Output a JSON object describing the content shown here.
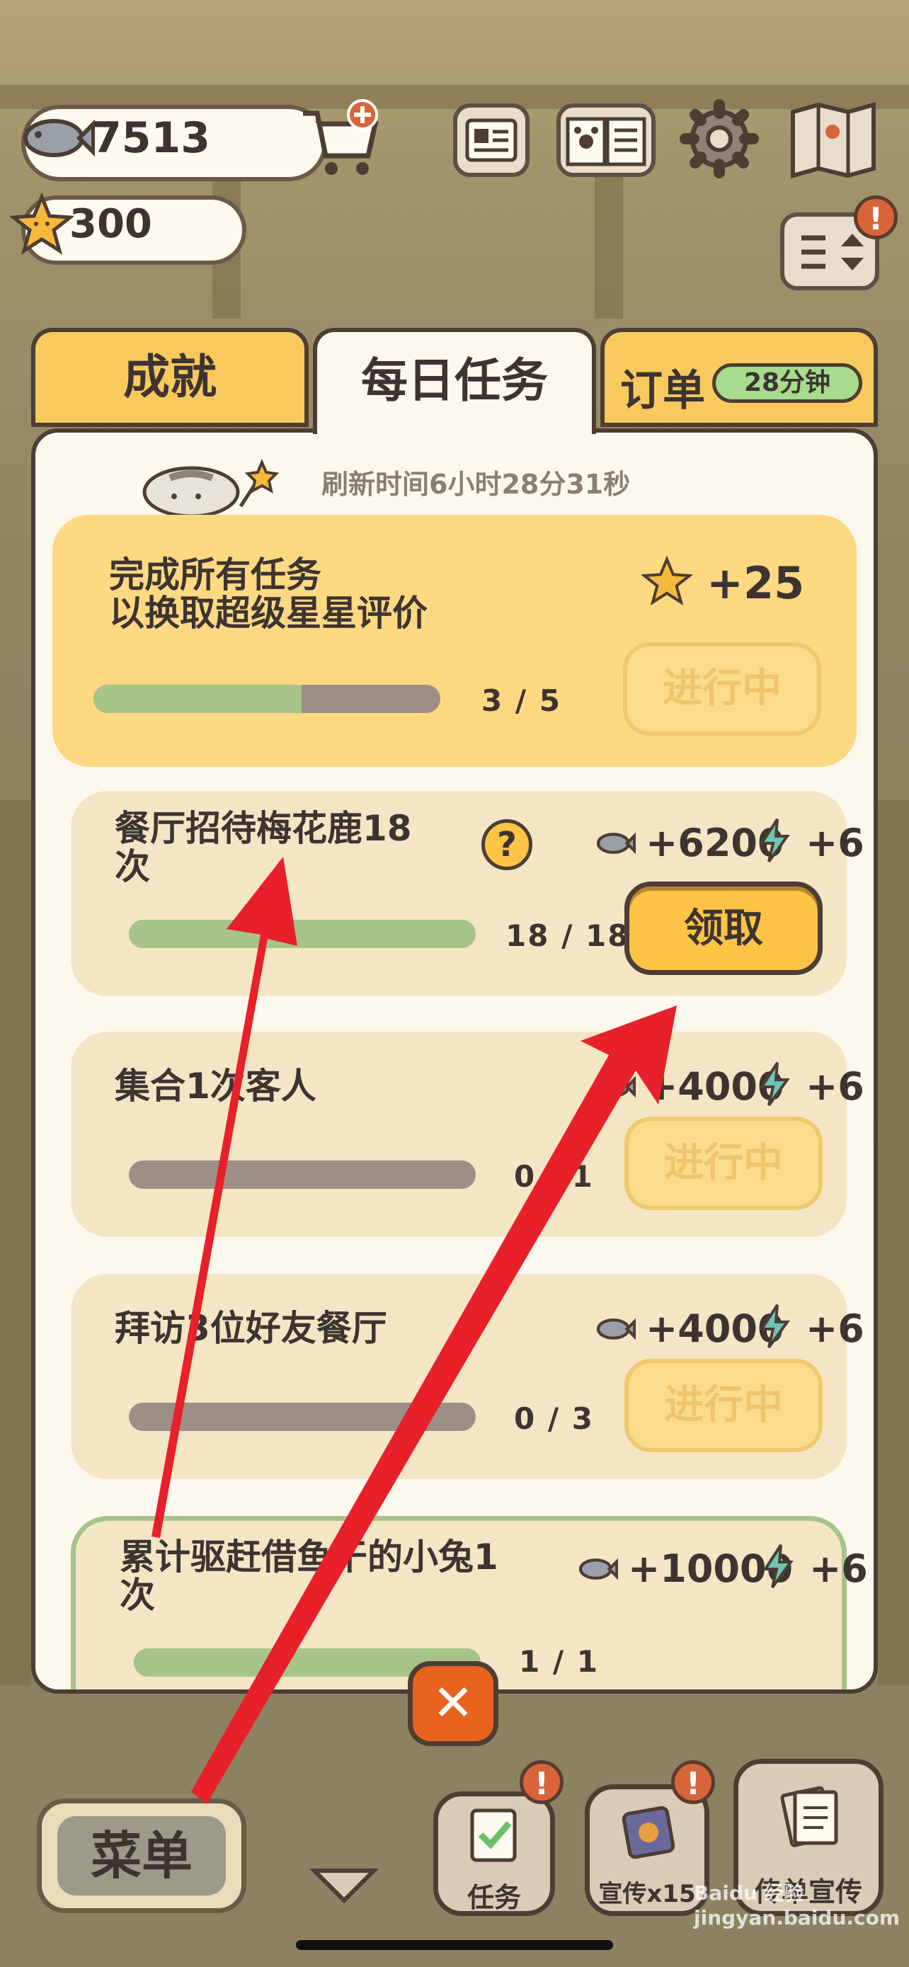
{
  "currency": {
    "fish": "7513",
    "stars": "300"
  },
  "tabs": [
    {
      "label": "成就"
    },
    {
      "label": "每日任务"
    },
    {
      "label": "订单",
      "timer": "28分钟"
    }
  ],
  "refresh_text": "刷新时间6小时28分31秒",
  "tasks": [
    {
      "title": "完成所有任务\n以换取超级星星评价",
      "reward_star": "+25",
      "progress": "3 / 5",
      "progress_fraction": 0.6,
      "button": "进行中"
    },
    {
      "title": "餐厅招待梅花鹿18\n次",
      "reward_fish": "+6200",
      "reward_energy": "+6",
      "progress": "18 / 18",
      "progress_fraction": 1.0,
      "button": "领取"
    },
    {
      "title": "集合1次客人",
      "reward_fish": "+4000",
      "reward_energy": "+6",
      "progress": "0 / 1",
      "progress_fraction": 0,
      "button": "进行中"
    },
    {
      "title": "拜访3位好友餐厅",
      "reward_fish": "+4000",
      "reward_energy": "+6",
      "progress": "0 / 3",
      "progress_fraction": 0,
      "button": "进行中"
    },
    {
      "title": "累计驱赶借鱼干的小兔1\n次",
      "reward_fish": "+10000",
      "reward_energy": "+6",
      "progress": "1 / 1",
      "progress_fraction": 1.0,
      "button": ""
    }
  ],
  "close_symbol": "✕",
  "bottom": {
    "menu": "菜单",
    "task": "任务",
    "promo": "宣传x15",
    "flyer": "传单宣传"
  },
  "watermark": "Baidu 经验 jingyan.baidu.com",
  "colors": {
    "accent_yellow": "#fdc445",
    "panel_bg": "#fdf8ee",
    "bar_green": "#a6c489",
    "arrow_red": "#e8202a"
  }
}
